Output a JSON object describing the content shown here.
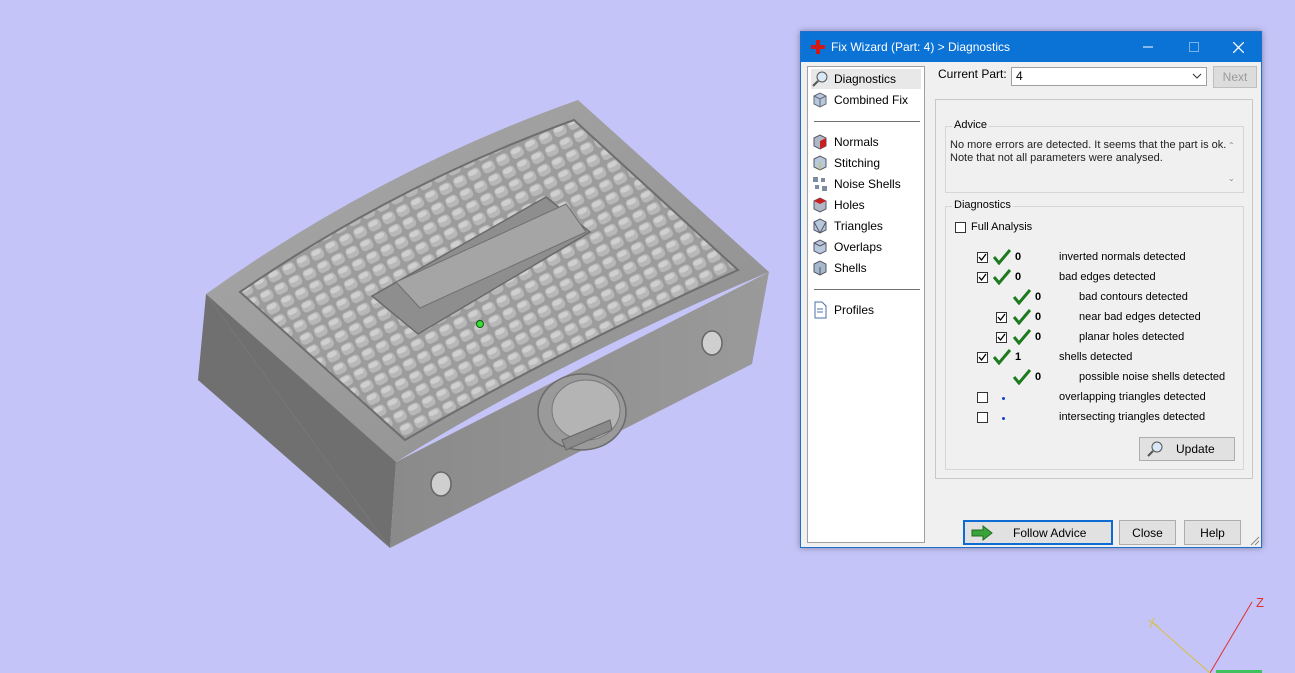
{
  "dialog": {
    "title": "Fix Wizard (Part: 4) > Diagnostics",
    "nav": {
      "top": [
        "Diagnostics",
        "Combined Fix"
      ],
      "tools": [
        "Normals",
        "Stitching",
        "Noise Shells",
        "Holes",
        "Triangles",
        "Overlaps",
        "Shells"
      ],
      "bottom": [
        "Profiles"
      ]
    },
    "current_part_label": "Current Part:",
    "current_part_value": "4",
    "next_button": "Next",
    "advice_legend": "Advice",
    "advice_text": "No more errors are detected. It seems that the part is ok. Note that not all parameters were analysed.",
    "diagnostics_legend": "Diagnostics",
    "full_analysis_label": "Full Analysis",
    "rows": [
      {
        "checked": true,
        "status": "ok",
        "count": "0",
        "text": "inverted normals detected",
        "level": 0
      },
      {
        "checked": true,
        "status": "ok",
        "count": "0",
        "text": "bad edges detected",
        "level": 0
      },
      {
        "checkbox": false,
        "status": "ok",
        "count": "0",
        "text": "bad contours detected",
        "level": 1
      },
      {
        "checked": true,
        "status": "ok",
        "count": "0",
        "text": "near bad edges detected",
        "level": 1
      },
      {
        "checked": true,
        "status": "ok",
        "count": "0",
        "text": "planar holes detected",
        "level": 1
      },
      {
        "checked": true,
        "status": "ok",
        "count": "1",
        "text": "shells detected",
        "level": 0
      },
      {
        "checkbox": false,
        "status": "ok",
        "count": "0",
        "text": "possible noise shells detected",
        "level": 1
      },
      {
        "checked": false,
        "status": "none",
        "count": "",
        "text": "overlapping triangles detected",
        "level": 0
      },
      {
        "checked": false,
        "status": "none",
        "count": "",
        "text": "intersecting triangles detected",
        "level": 0
      }
    ],
    "update_button": "Update",
    "follow_advice_button": "Follow Advice",
    "close_button": "Close",
    "help_button": "Help"
  },
  "axes": {
    "z_label": "Z"
  },
  "colors": {
    "background": "#c4c4f8",
    "titlebar": "#0c73d6",
    "check": "#1e7a1e",
    "dot": "#1a3fd1"
  }
}
